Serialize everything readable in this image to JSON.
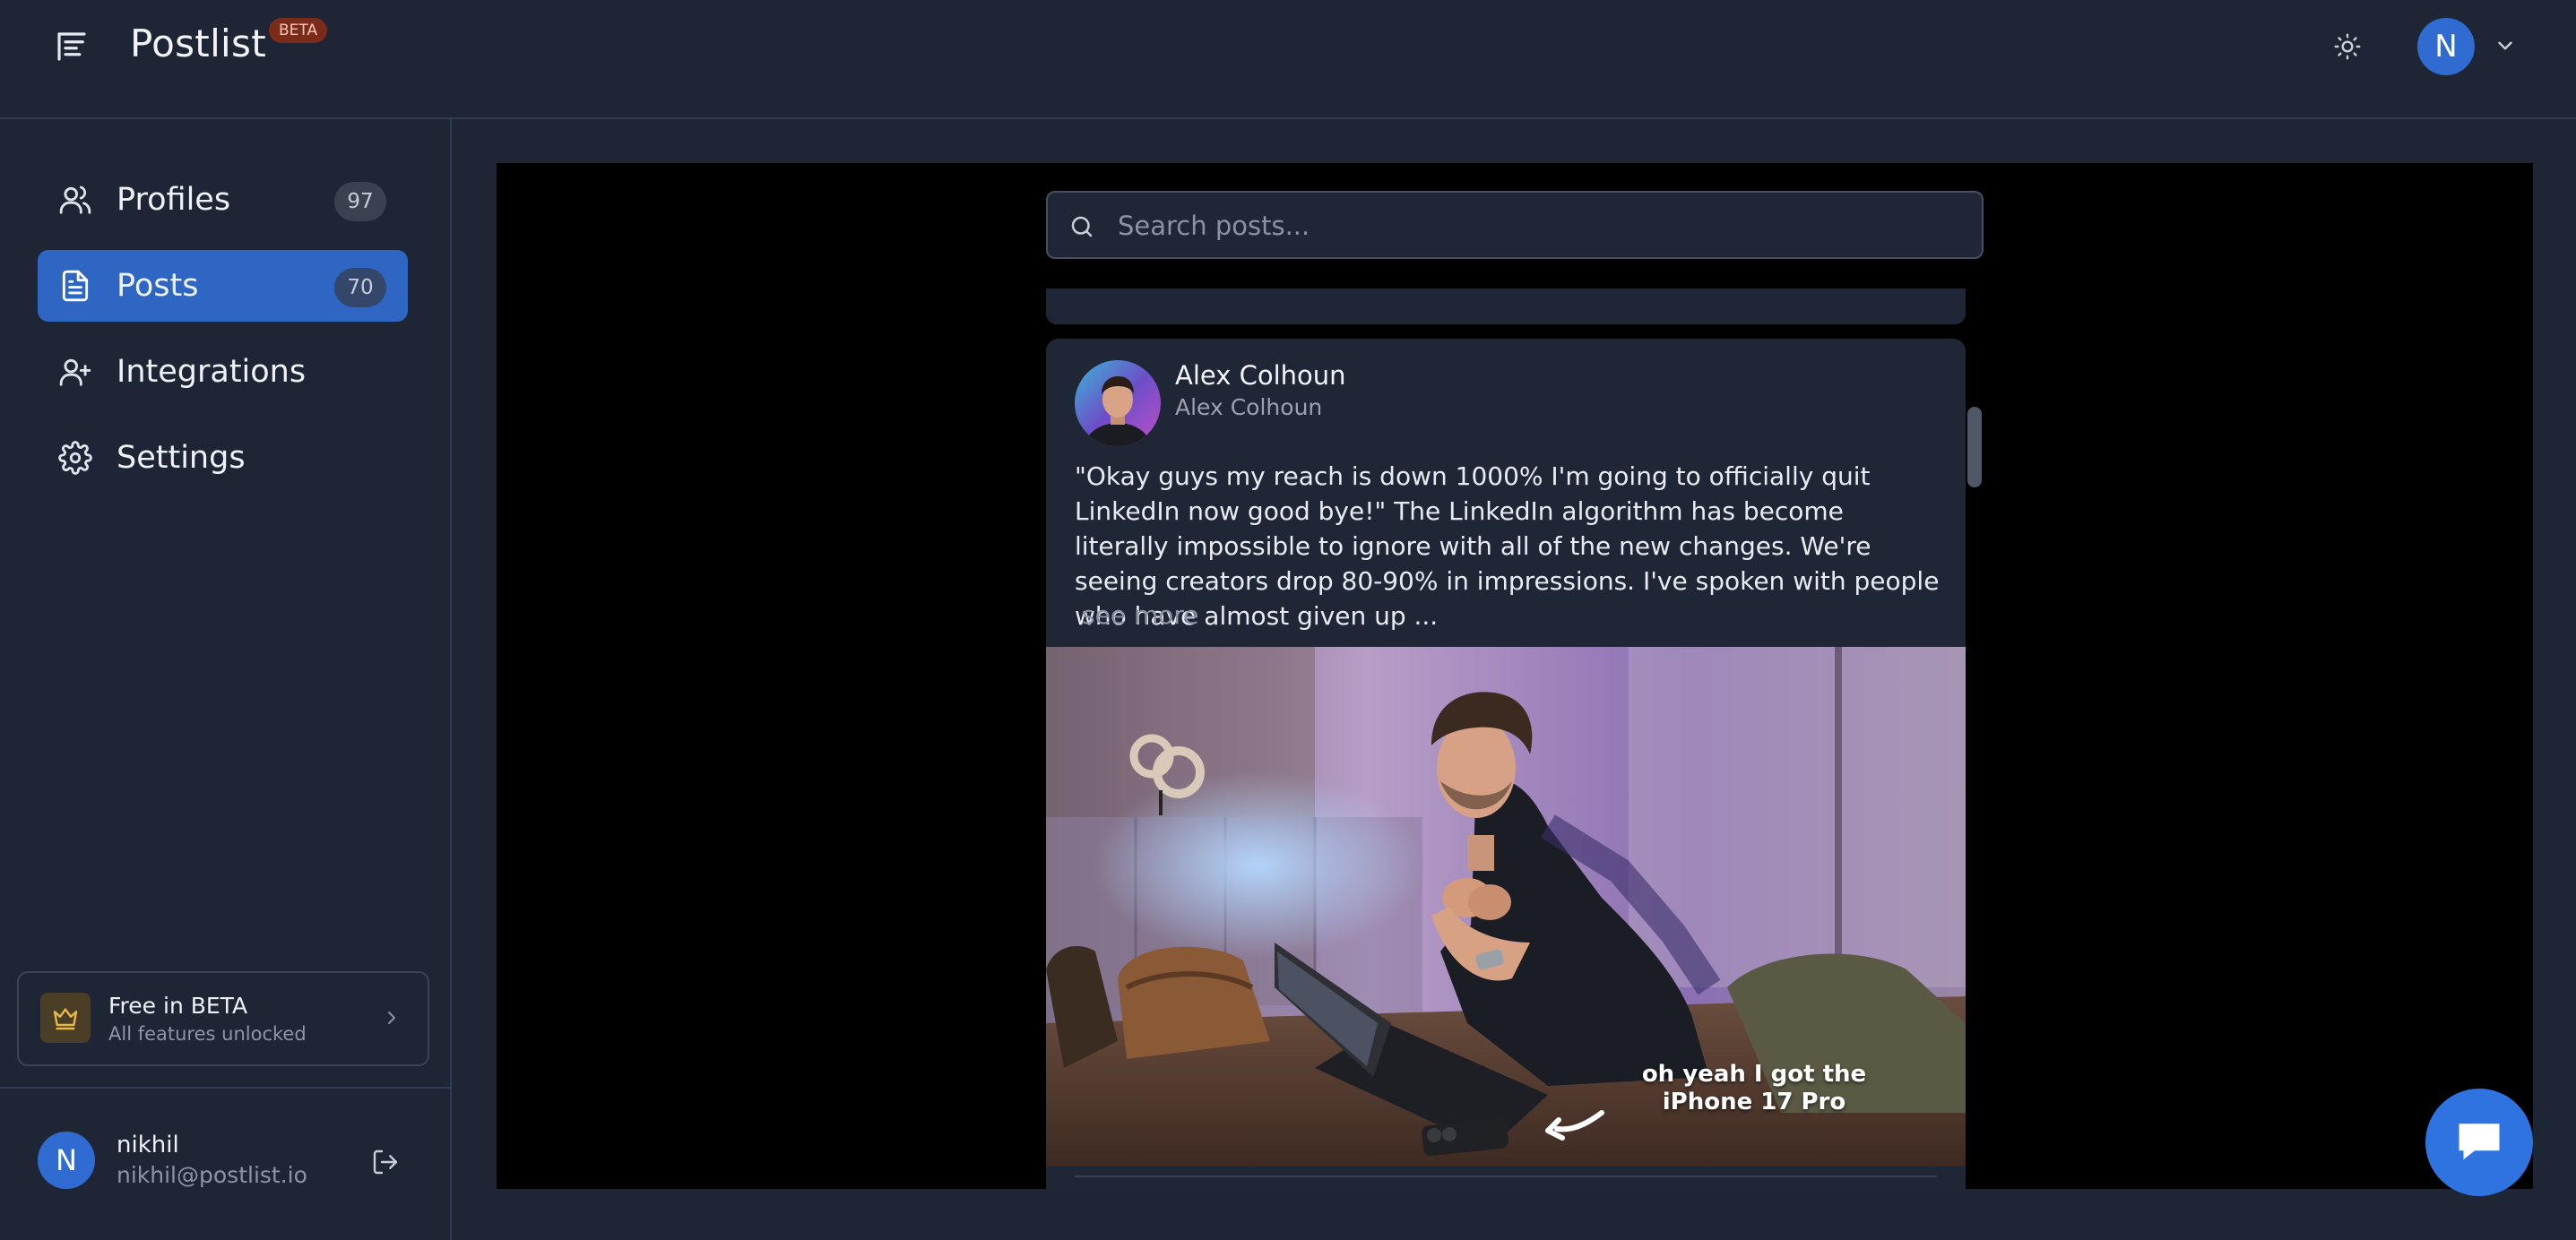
{
  "header": {
    "brand": "Postlist",
    "beta_badge": "BETA",
    "user_initial": "N",
    "icons": {
      "menu": "menu-icon",
      "theme": "sun-icon",
      "dropdown": "chevron-down-icon"
    }
  },
  "sidebar": {
    "items": [
      {
        "label": "Profiles",
        "count": "97",
        "icon": "users-icon",
        "active": false
      },
      {
        "label": "Posts",
        "count": "70",
        "icon": "document-icon",
        "active": true
      },
      {
        "label": "Integrations",
        "count": null,
        "icon": "user-plus-icon",
        "active": false
      },
      {
        "label": "Settings",
        "count": null,
        "icon": "gear-icon",
        "active": false
      }
    ],
    "beta_card": {
      "title": "Free in BETA",
      "subtitle": "All features unlocked",
      "icon": "crown-icon"
    },
    "user": {
      "initial": "N",
      "name": "nikhil",
      "email": "nikhil@postlist.io"
    }
  },
  "main": {
    "search": {
      "placeholder": "Search posts...",
      "value": ""
    },
    "post": {
      "author_name": "Alex Colhoun",
      "author_handle": "Alex Colhoun",
      "text": "\"Okay guys my reach is down 1000% I'm going to officially quit LinkedIn now good bye!\" The LinkedIn algorithm has become literally impossible to ignore with all of the new changes. We're seeing creators drop 80-90% in impressions. I've spoken with people who have almost given up ...",
      "see_more": "see more",
      "image_caption_line1": "oh yeah I got the",
      "image_caption_line2": "iPhone 17 Pro"
    }
  },
  "colors": {
    "background": "#1e2636",
    "accent": "#2f66c4",
    "beta_badge": "#7a2b1a",
    "chat_button": "#2f73e0"
  }
}
